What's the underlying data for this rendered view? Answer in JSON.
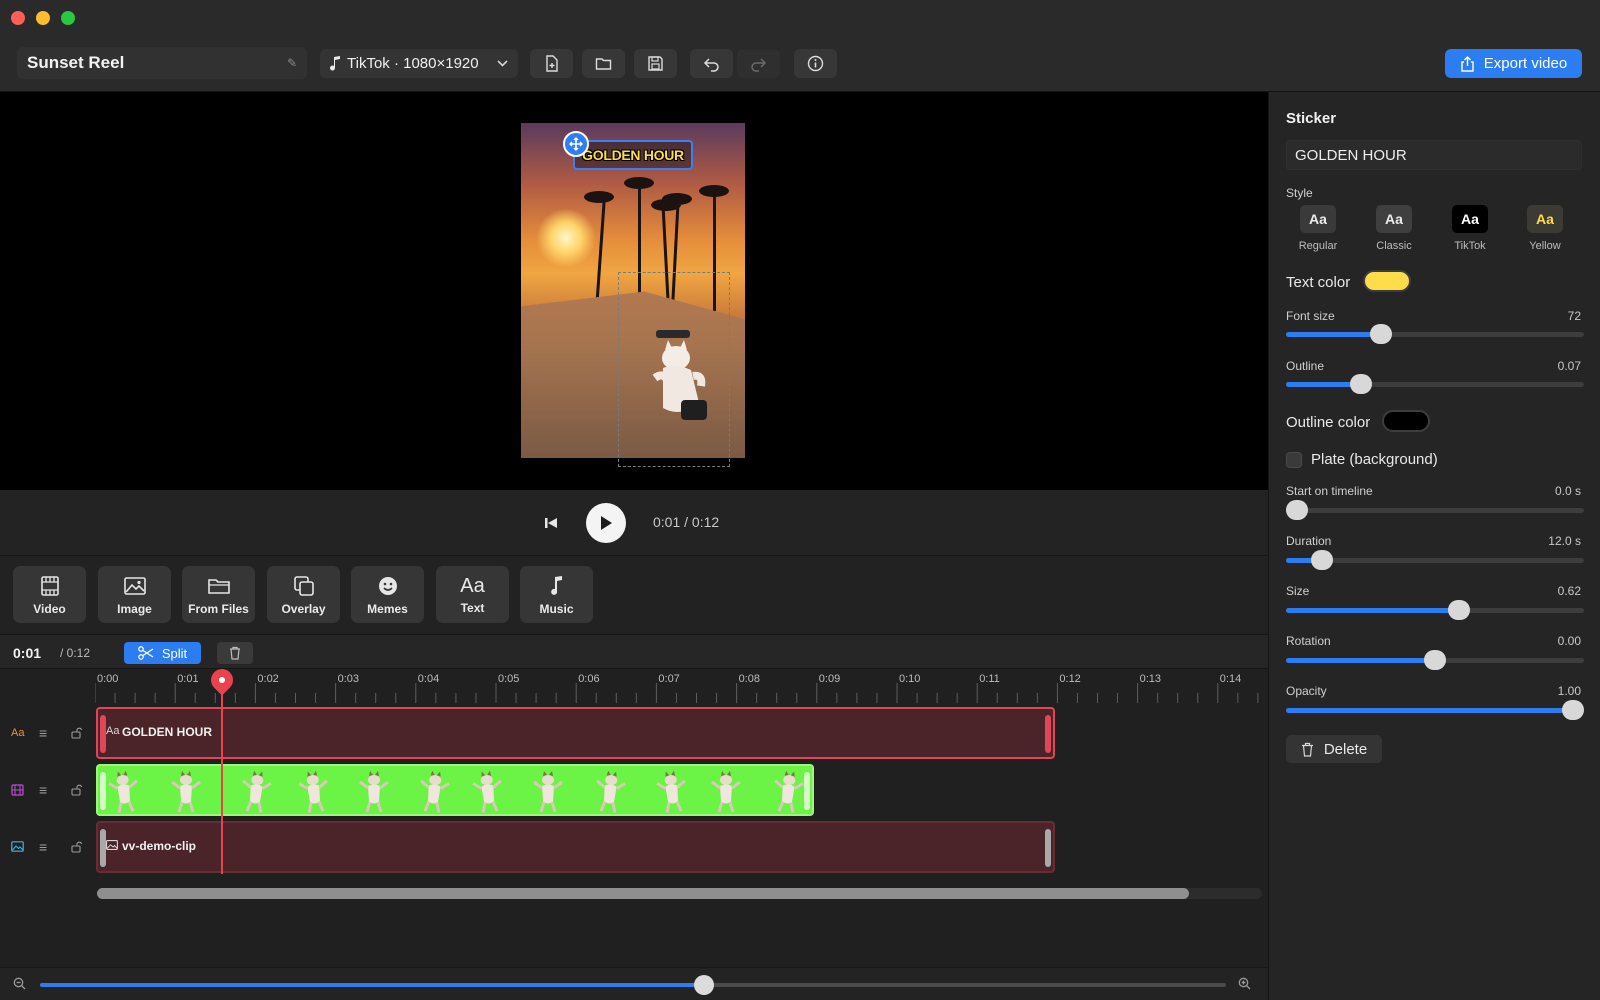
{
  "project": {
    "name": "Sunset Reel"
  },
  "preset": {
    "label": "TikTok · 1080×1920"
  },
  "toolbar": {
    "export_label": "Export video"
  },
  "preview": {
    "sticker_text": "GOLDEN HOUR"
  },
  "transport": {
    "time": "0:01 / 0:12"
  },
  "tools": [
    {
      "label": "Video",
      "icon": "film-icon"
    },
    {
      "label": "Image",
      "icon": "image-icon"
    },
    {
      "label": "From Files",
      "icon": "folder-icon"
    },
    {
      "label": "Overlay",
      "icon": "overlay-icon"
    },
    {
      "label": "Memes",
      "icon": "smiley-icon"
    },
    {
      "label": "Text",
      "icon": "text-icon"
    },
    {
      "label": "Music",
      "icon": "music-note-icon"
    }
  ],
  "timeline": {
    "current": "0:01",
    "total": "/ 0:12",
    "split_label": "Split",
    "ruler": [
      "0:00",
      "0:01",
      "0:02",
      "0:03",
      "0:04",
      "0:05",
      "0:06",
      "0:07",
      "0:08",
      "0:09",
      "0:10",
      "0:11",
      "0:12",
      "0:13",
      "0:14"
    ],
    "tracks": [
      {
        "type": "text",
        "icon": "Aa",
        "label": "GOLDEN HOUR",
        "color": "#e04653"
      },
      {
        "type": "animation",
        "label": "",
        "color": "#6bf345"
      },
      {
        "type": "image",
        "label": "vv-demo-clip",
        "color": "#6a2b33"
      }
    ],
    "playhead_seconds": 1,
    "zoom_fraction": 0.56
  },
  "panel": {
    "title": "Sticker",
    "sticker_value": "GOLDEN HOUR",
    "style_label": "Style",
    "styles": [
      {
        "name": "Regular",
        "chip": "Aa"
      },
      {
        "name": "Classic",
        "chip": "Aa"
      },
      {
        "name": "TikTok",
        "chip": "Aa"
      },
      {
        "name": "Yellow",
        "chip": "Aa"
      }
    ],
    "text_color_label": "Text color",
    "text_color": "#ffdc4a",
    "font_size": {
      "label": "Font size",
      "value": "72",
      "fraction": 0.32
    },
    "outline": {
      "label": "Outline",
      "value": "0.07",
      "fraction": 0.25
    },
    "outline_color_label": "Outline color",
    "outline_color": "#000000",
    "plate_label": "Plate (background)",
    "start": {
      "label": "Start on timeline",
      "value": "0.0 s",
      "fraction": 0.0
    },
    "duration": {
      "label": "Duration",
      "value": "12.0 s",
      "fraction": 0.12
    },
    "size": {
      "label": "Size",
      "value": "0.62",
      "fraction": 0.58
    },
    "rotation": {
      "label": "Rotation",
      "value": "0.00",
      "fraction": 0.5
    },
    "opacity": {
      "label": "Opacity",
      "value": "1.00",
      "fraction": 1.0
    },
    "delete_label": "Delete"
  }
}
